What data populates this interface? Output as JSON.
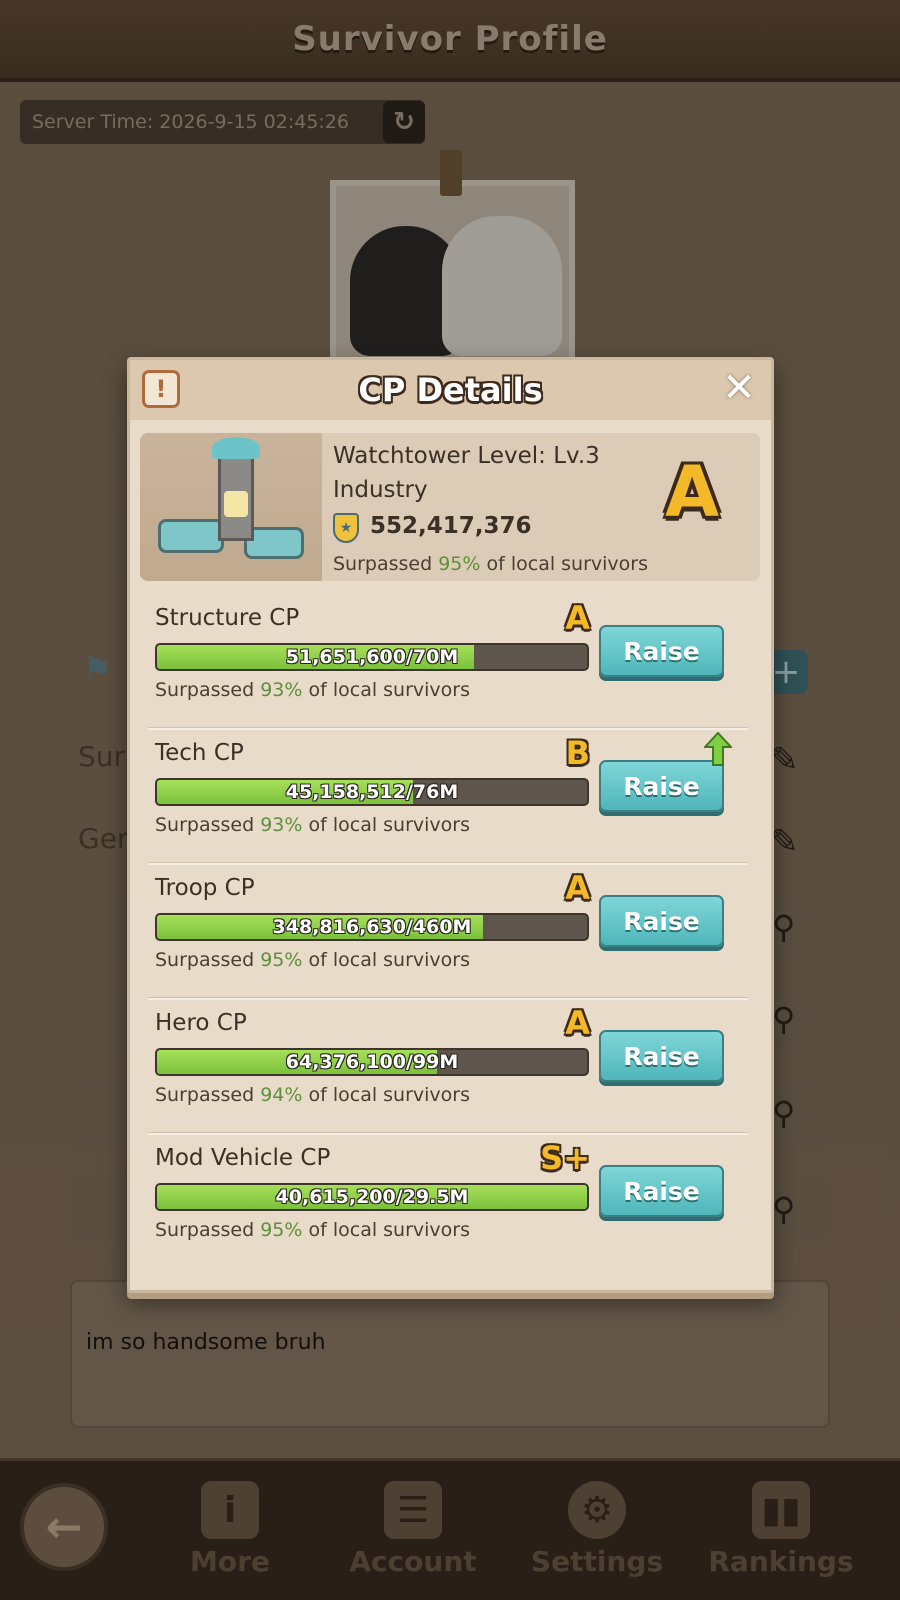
{
  "page": {
    "title": "Survivor Profile",
    "server_time": "Server Time: 2026-9-15 02:45:26",
    "bio": "im so handsome bruh",
    "partial_labels": [
      "Sur",
      "Gen"
    ]
  },
  "modal": {
    "title": "CP Details",
    "close_icon": "close-icon",
    "info_icon": "exclamation-icon",
    "summary": {
      "watchtower_level": "Watchtower Level: Lv.3",
      "type": "Industry",
      "total_cp": "552,417,376",
      "surpass_prefix": "Surpassed ",
      "surpass_pct": "95%",
      "surpass_suffix": " of local survivors",
      "grade": "A"
    },
    "rows": [
      {
        "name": "Structure CP",
        "grade": "A",
        "bar_text": "51,651,600/70M",
        "fill": 0.7379,
        "surpass_prefix": "Surpassed ",
        "pct": "93%",
        "surpass_suffix": " of local survivors",
        "button": "Raise",
        "upgrade_arrow": false
      },
      {
        "name": "Tech CP",
        "grade": "B",
        "bar_text": "45,158,512/76M",
        "fill": 0.5942,
        "surpass_prefix": "Surpassed ",
        "pct": "93%",
        "surpass_suffix": " of local survivors",
        "button": "Raise",
        "upgrade_arrow": true
      },
      {
        "name": "Troop CP",
        "grade": "A",
        "bar_text": "348,816,630/460M",
        "fill": 0.7583,
        "surpass_prefix": "Surpassed ",
        "pct": "95%",
        "surpass_suffix": " of local survivors",
        "button": "Raise",
        "upgrade_arrow": false
      },
      {
        "name": "Hero CP",
        "grade": "A",
        "bar_text": "64,376,100/99M",
        "fill": 0.6503,
        "surpass_prefix": "Surpassed ",
        "pct": "94%",
        "surpass_suffix": " of local survivors",
        "button": "Raise",
        "upgrade_arrow": false
      },
      {
        "name": "Mod Vehicle CP",
        "grade": "S+",
        "bar_text": "40,615,200/29.5M",
        "fill": 1.0,
        "surpass_prefix": "Surpassed ",
        "pct": "95%",
        "surpass_suffix": " of local survivors",
        "button": "Raise",
        "upgrade_arrow": false
      }
    ]
  },
  "nav": {
    "back_icon": "back-arrow-icon",
    "items": [
      {
        "label": "More",
        "icon": "info-icon"
      },
      {
        "label": "Account",
        "icon": "account-card-icon"
      },
      {
        "label": "Settings",
        "icon": "gear-icon"
      },
      {
        "label": "Rankings",
        "icon": "bar-chart-icon"
      }
    ]
  },
  "colors": {
    "accent_green": "#7bc13a",
    "grade_gold": "#f4b928",
    "button_teal": "#4fb6ba",
    "percent_green": "#5e8f3b"
  }
}
